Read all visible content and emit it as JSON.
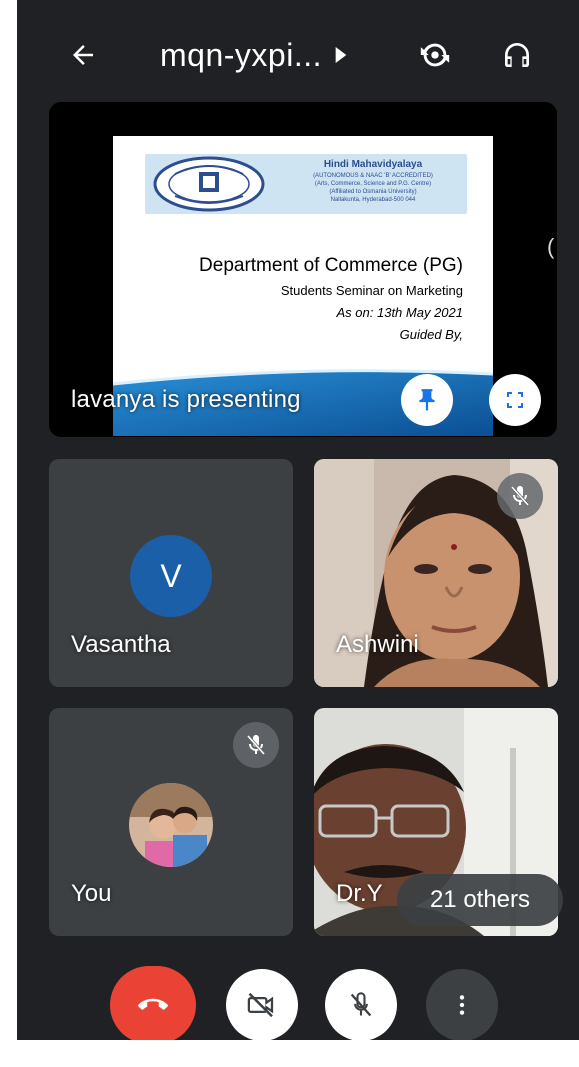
{
  "header": {
    "meeting_code": "mqn-yxpi...",
    "icons": [
      "back-arrow-icon",
      "caret-right-icon",
      "switch-camera-icon",
      "headphones-icon"
    ]
  },
  "presentation": {
    "presenter_label": "lavanya is presenting",
    "slide": {
      "college_name": "Hindi Mahavidyalaya",
      "college_line1": "(AUTONOMOUS & NAAC 'B' ACCREDITED)",
      "college_line2": "(Arts, Commerce, Science and P.G. Centre)",
      "college_line3": "(Affiliated to Osmania University)",
      "college_line4": "Nallakunta, Hyderabad-500 044",
      "title": "Department of Commerce (PG)",
      "subtitle": "Students Seminar on Marketing",
      "date": "As on: 13th May 2021",
      "guided": "Guided By,"
    },
    "icons": [
      "pin-icon",
      "fullscreen-icon"
    ]
  },
  "participants": [
    {
      "name": "Vasantha",
      "avatar_letter": "V",
      "avatar_color": "#1a5fa8",
      "muted": false
    },
    {
      "name": "Ashwini",
      "muted": true
    },
    {
      "name": "You",
      "muted": true
    },
    {
      "name": "Dr.Y",
      "muted": false
    }
  ],
  "others_chip": "21 others",
  "controls": {
    "icons": [
      "end-call-icon",
      "camera-off-icon",
      "mic-off-icon",
      "more-vert-icon"
    ]
  },
  "colors": {
    "background": "#202124",
    "tile": "#3c4043",
    "end_call": "#ea4335",
    "accent_blue": "#1a73e8"
  }
}
